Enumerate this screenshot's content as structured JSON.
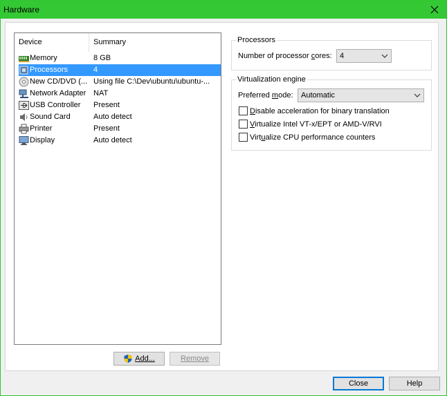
{
  "window": {
    "title": "Hardware"
  },
  "device_list": {
    "columns": [
      "Device",
      "Summary"
    ],
    "rows": [
      {
        "device": "Memory",
        "summary": "8 GB",
        "icon": "memory-icon"
      },
      {
        "device": "Processors",
        "summary": "4",
        "icon": "processor-icon",
        "selected": true
      },
      {
        "device": "New CD/DVD (...",
        "summary": "Using file C:\\Dev\\ubuntu\\ubuntu-...",
        "icon": "cd-dvd-icon"
      },
      {
        "device": "Network Adapter",
        "summary": "NAT",
        "icon": "network-adapter-icon"
      },
      {
        "device": "USB Controller",
        "summary": "Present",
        "icon": "usb-icon"
      },
      {
        "device": "Sound Card",
        "summary": "Auto detect",
        "icon": "sound-card-icon"
      },
      {
        "device": "Printer",
        "summary": "Present",
        "icon": "printer-icon"
      },
      {
        "device": "Display",
        "summary": "Auto detect",
        "icon": "display-icon"
      }
    ]
  },
  "list_buttons": {
    "add": "Add...",
    "remove": "Remove"
  },
  "processors": {
    "group_title": "Processors",
    "cores_label_pre": "Number of processor ",
    "cores_label_u": "c",
    "cores_label_post": "ores:",
    "cores_value": "4"
  },
  "virtualization": {
    "group_title": "Virtualization engine",
    "mode_label_pre": "Preferred ",
    "mode_label_u": "m",
    "mode_label_post": "ode:",
    "mode_value": "Automatic",
    "options": [
      {
        "u": "D",
        "rest": "isable acceleration for binary translation",
        "checked": false
      },
      {
        "u": "V",
        "rest": "irtualize Intel VT-x/EPT or AMD-V/RVI",
        "checked": false
      },
      {
        "pre": "Virt",
        "u": "u",
        "rest": "alize CPU performance counters",
        "checked": false
      }
    ]
  },
  "footer": {
    "close": "Close",
    "help": "Help"
  }
}
